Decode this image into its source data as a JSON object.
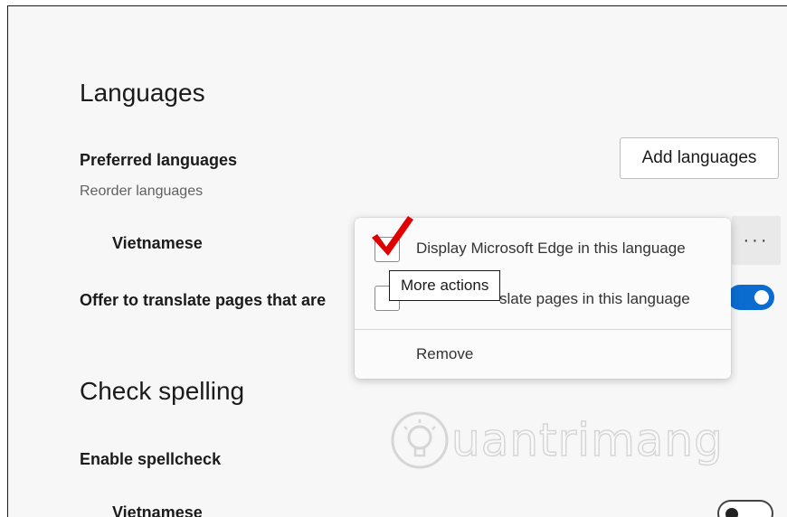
{
  "page": {
    "languages_heading": "Languages",
    "preferred_languages_label": "Preferred languages",
    "reorder_hint": "Reorder languages",
    "add_languages_button": "Add languages",
    "language_row": {
      "name": "Vietnamese",
      "more_actions_glyph": "···"
    },
    "offer_translate_label": "Offer to translate pages that are",
    "offer_translate_enabled": true,
    "check_spelling_heading": "Check spelling",
    "enable_spellcheck_label": "Enable spellcheck",
    "spellcheck_language_row": {
      "name": "Vietnamese",
      "enabled": false
    }
  },
  "context_menu": {
    "items": [
      {
        "label": "Display Microsoft Edge in this language",
        "type": "checkbox",
        "checked": false
      },
      {
        "label": "slate pages in this language",
        "type": "checkbox",
        "checked": false
      },
      {
        "label": "Remove",
        "type": "action"
      }
    ]
  },
  "tooltip": {
    "text": "More actions"
  },
  "annotation": {
    "icon": "red-checkmark-icon",
    "color": "#e00000"
  },
  "watermark": {
    "text": "uantrimang",
    "icon": "lightbulb-icon"
  },
  "colors": {
    "accent": "#0a6cd1",
    "background": "#f7f7f7"
  }
}
